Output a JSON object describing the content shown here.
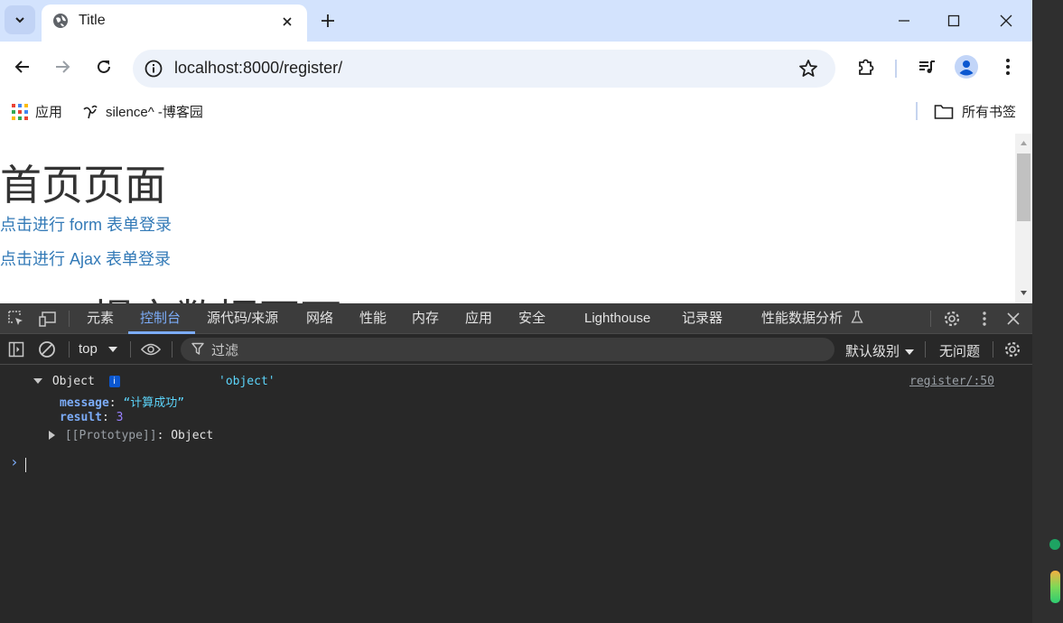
{
  "tab": {
    "title": "Title"
  },
  "omnibox": {
    "url": "localhost:8000/register/"
  },
  "bookmarks": {
    "apps_label": "应用",
    "item1_label": "silence^ -博客园",
    "all_label": "所有书签"
  },
  "page": {
    "heading": "首页页面",
    "link_form": "点击进行 form 表单登录",
    "link_ajax": "点击进行 Ajax 表单登录",
    "heading2": "Ajax 提交数据页面"
  },
  "devtools": {
    "tabs": [
      "元素",
      "控制台",
      "源代码/来源",
      "网络",
      "性能",
      "内存",
      "应用",
      "安全",
      "Lighthouse",
      "记录器",
      "性能数据分析"
    ],
    "active_tab": "控制台",
    "context": "top",
    "filter_placeholder": "过滤",
    "level": "默认级别",
    "issues": "无问题"
  },
  "console": {
    "obj_label": "Object",
    "info": "i",
    "type_str": "'object'",
    "source": "register/:50",
    "message_key": "message",
    "message_val": "“计算成功”",
    "result_key": "result",
    "result_val": "3",
    "proto_key": "[[Prototype]]",
    "proto_val": "Object",
    "prompt": "›"
  },
  "colors": {
    "tabstrip": "#d3e3fd",
    "link": "#337ab7",
    "devtools_accent": "#7cacf8"
  },
  "icons": [
    "chevron-down-icon",
    "globe-icon",
    "close-icon",
    "plus-icon",
    "minimize-icon",
    "maximize-icon",
    "back-icon",
    "forward-icon",
    "reload-icon",
    "info-icon",
    "star-icon",
    "extensions-icon",
    "media-icon",
    "profile-icon",
    "menu-icon",
    "apps-icon",
    "folder-icon",
    "inspect-icon",
    "device-icon",
    "gear-icon",
    "sidebar-icon",
    "clear-icon",
    "eye-icon",
    "filter-icon",
    "flask-icon"
  ]
}
